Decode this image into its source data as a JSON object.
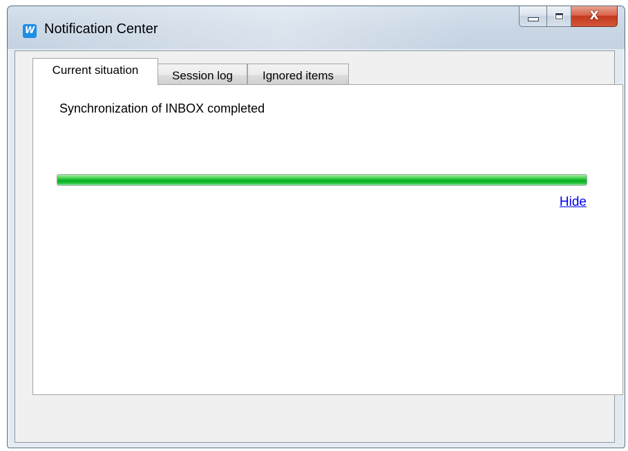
{
  "window": {
    "title": "Notification Center",
    "icon": "app-w-icon",
    "icon_letter": "W",
    "icon_color": "#1e8ee6"
  },
  "caption_buttons": {
    "minimize": "minimize-icon",
    "maximize": "maximize-icon",
    "close": "close-icon",
    "close_glyph": "X"
  },
  "tabs": [
    {
      "label": "Current situation",
      "active": true
    },
    {
      "label": "Session log",
      "active": false
    },
    {
      "label": "Ignored items",
      "active": false
    }
  ],
  "current_situation": {
    "status_text": "Synchronization of INBOX completed",
    "progress_percent": 100,
    "progress_color": "#06b025",
    "hide_link": "Hide"
  }
}
